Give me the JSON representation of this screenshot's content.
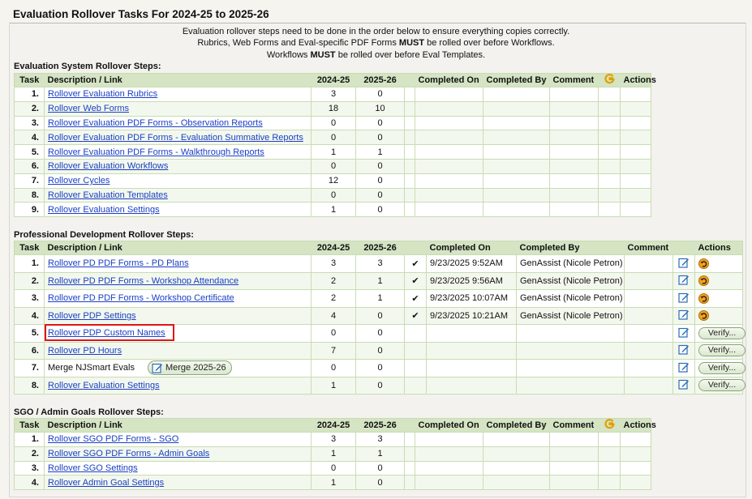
{
  "page": {
    "title": "Evaluation Rollover Tasks For 2024-25 to 2025-26",
    "intro_line1": "Evaluation rollover steps need to be done in the order below to ensure everything copies correctly.",
    "intro_line2_a": "Rubrics, Web Forms and Eval-specific PDF Forms ",
    "intro_line2_b": "MUST",
    "intro_line2_c": " be rolled over before Workflows.",
    "intro_line3_a": "Workflows ",
    "intro_line3_b": "MUST",
    "intro_line3_c": " be rolled over before Eval Templates."
  },
  "headers": {
    "task": "Task",
    "desc": "Description / Link",
    "y1": "2024-25",
    "y2": "2025-26",
    "completed_on": "Completed On",
    "completed_by": "Completed By",
    "comment": "Comment",
    "actions": "Actions"
  },
  "eval": {
    "title": "Evaluation System Rollover Steps:",
    "rows": [
      {
        "task": "1.",
        "desc": "Rollover Evaluation Rubrics",
        "y1": "3",
        "y2": "0"
      },
      {
        "task": "2.",
        "desc": "Rollover Web Forms",
        "y1": "18",
        "y2": "10"
      },
      {
        "task": "3.",
        "desc": "Rollover Evaluation PDF Forms - Observation Reports",
        "y1": "0",
        "y2": "0"
      },
      {
        "task": "4.",
        "desc": "Rollover Evaluation PDF Forms - Evaluation Summative Reports",
        "y1": "0",
        "y2": "0"
      },
      {
        "task": "5.",
        "desc": "Rollover Evaluation PDF Forms - Walkthrough Reports",
        "y1": "1",
        "y2": "1"
      },
      {
        "task": "6.",
        "desc": "Rollover Evaluation Workflows",
        "y1": "0",
        "y2": "0"
      },
      {
        "task": "7.",
        "desc": "Rollover Cycles",
        "y1": "12",
        "y2": "0"
      },
      {
        "task": "8.",
        "desc": "Rollover Evaluation Templates",
        "y1": "0",
        "y2": "0"
      },
      {
        "task": "9.",
        "desc": "Rollover Evaluation Settings",
        "y1": "1",
        "y2": "0"
      }
    ]
  },
  "pd": {
    "title": "Professional Development Rollover Steps:",
    "verify_label": "Verify...",
    "merge_label": "Merge 2025-26",
    "rows": [
      {
        "task": "1.",
        "desc": "Rollover PD PDF Forms - PD Plans",
        "y1": "3",
        "y2": "3",
        "done": "✔",
        "on": "9/23/2025 9:52AM",
        "by": "GenAssist (Nicole Petron)"
      },
      {
        "task": "2.",
        "desc": "Rollover PD PDF Forms - Workshop Attendance",
        "y1": "2",
        "y2": "1",
        "done": "✔",
        "on": "9/23/2025 9:56AM",
        "by": "GenAssist (Nicole Petron)"
      },
      {
        "task": "3.",
        "desc": "Rollover PD PDF Forms - Workshop Certificate",
        "y1": "2",
        "y2": "1",
        "done": "✔",
        "on": "9/23/2025 10:07AM",
        "by": "GenAssist (Nicole Petron)"
      },
      {
        "task": "4.",
        "desc": "Rollover PDP Settings",
        "y1": "4",
        "y2": "0",
        "done": "✔",
        "on": "9/23/2025 10:21AM",
        "by": "GenAssist (Nicole Petron)"
      },
      {
        "task": "5.",
        "desc": "Rollover PDP Custom Names",
        "y1": "0",
        "y2": "0"
      },
      {
        "task": "6.",
        "desc": "Rollover PD Hours",
        "y1": "7",
        "y2": "0"
      },
      {
        "task": "7.",
        "desc": "Merge NJSmart Evals",
        "y1": "0",
        "y2": "0"
      },
      {
        "task": "8.",
        "desc": "Rollover Evaluation Settings",
        "y1": "1",
        "y2": "0"
      }
    ]
  },
  "sgo": {
    "title": "SGO / Admin Goals Rollover Steps:",
    "rows": [
      {
        "task": "1.",
        "desc": "Rollover SGO PDF Forms - SGO",
        "y1": "3",
        "y2": "3"
      },
      {
        "task": "2.",
        "desc": "Rollover SGO PDF Forms - Admin Goals",
        "y1": "1",
        "y2": "1"
      },
      {
        "task": "3.",
        "desc": "Rollover SGO Settings",
        "y1": "0",
        "y2": "0"
      },
      {
        "task": "4.",
        "desc": "Rollover Admin Goal Settings",
        "y1": "1",
        "y2": "0"
      }
    ]
  },
  "colors": {
    "header_bg": "#d5e4c3",
    "link": "#1a3fc4",
    "highlight": "#e01616",
    "undo": "#f0a21e"
  },
  "icons": {
    "g": "google-g-icon",
    "edit": "edit-note-icon",
    "undo": "undo-icon"
  }
}
